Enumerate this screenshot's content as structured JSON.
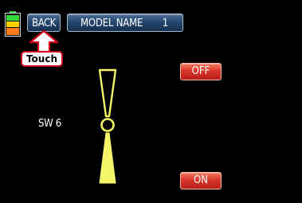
{
  "header": {
    "back_label": "BACK",
    "model_name_label": "MODEL NAME",
    "model_number": "1"
  },
  "battery": {
    "level_fraction": 0.8,
    "colors": [
      "#ff3a2a",
      "#ffd000",
      "#36d63a"
    ]
  },
  "annotation": {
    "touch_label": "Touch",
    "color": "#d0001a"
  },
  "switch": {
    "label": "SW 6",
    "position": "on",
    "color": "#f5f56a"
  },
  "buttons": {
    "off_label": "OFF",
    "on_label": "ON"
  },
  "colors": {
    "background": "#000000",
    "nav_button": "#26476f",
    "state_button": "#d8362b"
  }
}
